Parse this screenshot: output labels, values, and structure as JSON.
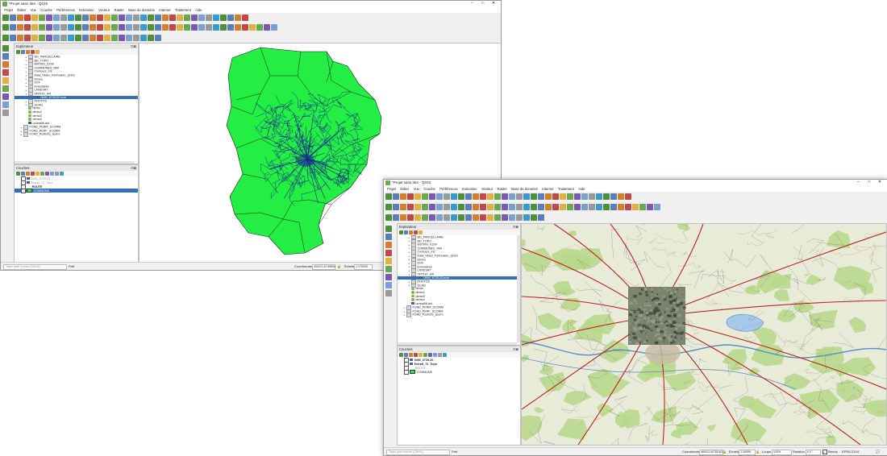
{
  "windows": {
    "w1": {
      "title": "*Projet sans titre - QGIS",
      "browser_title": "Explorateur",
      "layers_title": "Couches",
      "browser_items": [
        {
          "label": "BD_PARCELLAIRE",
          "icon": "folder",
          "expand": true
        },
        {
          "label": "BD_TOPO",
          "icon": "folder",
          "expand": true
        },
        {
          "label": "BdOrtho_ECW",
          "icon": "folder",
          "expand": true
        },
        {
          "label": "COMMUNES_MHI",
          "icon": "folder",
          "expand": true
        },
        {
          "label": "Contours_Iris",
          "icon": "folder",
          "expand": true
        },
        {
          "label": "Data_Video_Formulaire_QGIS",
          "icon": "folder",
          "expand": true
        },
        {
          "label": "Divers",
          "icon": "folder",
          "expand": true
        },
        {
          "label": "DVF",
          "icon": "folder",
          "expand": true
        },
        {
          "label": "formulaires",
          "icon": "folder",
          "expand": true
        },
        {
          "label": "LANDSAT",
          "icon": "folder",
          "expand": true
        },
        {
          "label": "ORTHO_HR",
          "icon": "folder",
          "expand": true,
          "open": true
        },
        {
          "label": "0490_6739-20.ecw",
          "icon": "raster",
          "indent": true,
          "selected": true
        },
        {
          "label": "PHOTOS",
          "icon": "folder",
          "expand": true
        },
        {
          "label": "SCAN",
          "icon": "folder",
          "expand": true
        },
        {
          "label": "demo",
          "icon": "db"
        },
        {
          "label": "demo2",
          "icon": "db"
        },
        {
          "label": "demo3",
          "icon": "db"
        },
        {
          "label": "demo4",
          "icon": "db"
        },
        {
          "label": "unrest06.dxt",
          "icon": "raster"
        },
        {
          "label": "FOAD_PERM_SCORM",
          "icon": "folder",
          "expand": true,
          "outdent": true
        },
        {
          "label": "FOAD_PERF_SCORM",
          "icon": "folder",
          "expand": true,
          "outdent": true
        },
        {
          "label": "FOAD_PostGIS_scorm",
          "icon": "folder",
          "expand": true,
          "outdent": true
        }
      ],
      "layers": [
        {
          "label": "0490_6739-20",
          "checked": false,
          "dim": true
        },
        {
          "label": "Extrait_72_Topo",
          "checked": false,
          "dim": true
        },
        {
          "label": "ROUTE",
          "checked": true,
          "bold": true
        },
        {
          "label": "COMMUNE",
          "checked": true,
          "selected": true
        }
      ],
      "status": {
        "search_placeholder": "Taper pour trouver (Ctrl+K)",
        "ready": "Prêt",
        "coord_label": "Coordonnée",
        "coord_value": "494121,6749694",
        "scale_label": "Échelle",
        "scale_value": "1:170034"
      },
      "colors": {
        "commune_fill": "#22ee44",
        "commune_border": "#222222",
        "route": "#1a2a8c"
      }
    },
    "w2": {
      "title": "*Projet sans titre - QGIS",
      "browser_title": "Explorateur",
      "layers_title": "Couches",
      "browser_items": [
        {
          "label": "BD_PARCELLAIRE",
          "icon": "folder",
          "expand": true
        },
        {
          "label": "BD_TOPO",
          "icon": "folder",
          "expand": true
        },
        {
          "label": "BdOrtho_ECW",
          "icon": "folder",
          "expand": true
        },
        {
          "label": "COMMUNES_MHI",
          "icon": "folder",
          "expand": true
        },
        {
          "label": "Contours_Iris",
          "icon": "folder",
          "expand": true
        },
        {
          "label": "Data_Video_Formulaire_QGIS",
          "icon": "folder",
          "expand": true
        },
        {
          "label": "Divers",
          "icon": "folder",
          "expand": true
        },
        {
          "label": "DVF",
          "icon": "folder",
          "expand": true
        },
        {
          "label": "formulaires",
          "icon": "folder",
          "expand": true
        },
        {
          "label": "LANDSAT",
          "icon": "folder",
          "expand": true
        },
        {
          "label": "ORTHO_HR",
          "icon": "folder",
          "expand": true,
          "open": true
        },
        {
          "label": "0490_6739-20.ecw",
          "icon": "raster",
          "indent": true,
          "selected": true
        },
        {
          "label": "PHOTOS",
          "icon": "folder",
          "expand": true
        },
        {
          "label": "SCAN",
          "icon": "folder",
          "expand": true
        },
        {
          "label": "demo",
          "icon": "db"
        },
        {
          "label": "demo2",
          "icon": "db"
        },
        {
          "label": "demo3",
          "icon": "db"
        },
        {
          "label": "demo4",
          "icon": "db"
        },
        {
          "label": "unrest06.dxt",
          "icon": "raster"
        },
        {
          "label": "FOAD_PERM_SCORM",
          "icon": "folder",
          "expand": true,
          "outdent": true
        },
        {
          "label": "FOAD_PERF_SCORM",
          "icon": "folder",
          "expand": true,
          "outdent": true
        },
        {
          "label": "FOAD_PostGIS_scorm",
          "icon": "folder",
          "expand": true,
          "outdent": true
        }
      ],
      "layers": [
        {
          "label": "0490_6739-20",
          "checked": true,
          "bold": true
        },
        {
          "label": "Extrait_72_Topo",
          "checked": true,
          "bold": true
        },
        {
          "label": "ROUTE",
          "checked": false,
          "dim": true
        },
        {
          "label": "COMMUNE",
          "checked": false
        }
      ],
      "status": {
        "search_placeholder": "Taper pour trouver (Ctrl+K)",
        "ready": "Prêt",
        "coord_label": "Coordonnée",
        "coord_value": "484412,6735183",
        "scale_label": "Échelle",
        "scale_value": "1:34999",
        "loupe_label": "Loupe",
        "loupe_value": "100%",
        "rotation_label": "Rotation",
        "rotation_value": "0,0 °",
        "render_label": "Rendu",
        "crs_label": "EPSG:2154"
      }
    }
  },
  "menu": [
    "Projet",
    "Éditer",
    "Vue",
    "Couche",
    "Préférences",
    "Extension",
    "Vecteur",
    "Raster",
    "Base de données",
    "Internet",
    "Traitement",
    "Aide"
  ],
  "window_controls": {
    "minimize": "–",
    "maximize": "□",
    "close": "✕"
  },
  "toolbar_colors": [
    "#5b7db8",
    "#e0b040",
    "#7aa0d0",
    "#4f8f3a",
    "#c04848",
    "#7a5ab0",
    "#3a9acd",
    "#d08030",
    "#6aa84f",
    "#999999"
  ],
  "basemap": {
    "ortho_dark": "#3a4234",
    "ortho_light": "#7b826d",
    "topo_bg": "#e8ebd8",
    "forest": "#b6d88a",
    "water": "#a6c8ea",
    "road": "#c22222"
  }
}
